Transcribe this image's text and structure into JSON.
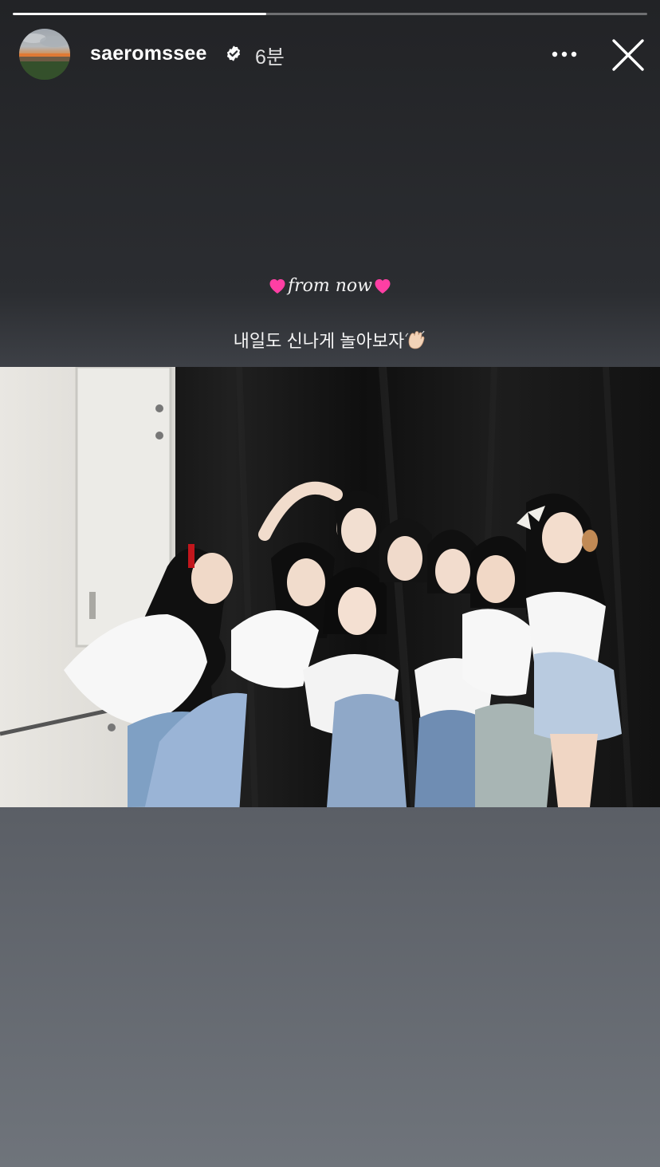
{
  "story": {
    "progress_fraction": 0.4
  },
  "header": {
    "username": "saeromssee",
    "time": "6분",
    "verified": true
  },
  "icons": {
    "more": "more-horizontal-icon",
    "close": "close-icon",
    "verified": "verified-badge-icon",
    "heart": "pink-heart-emoji",
    "wave": "waving-hand-emoji"
  },
  "caption": {
    "title": "from now",
    "subtitle": "내일도 신나게 놀아보자"
  },
  "colors": {
    "heart": "#ff3fa4",
    "background_top": "#222326",
    "background_bottom": "#6f747b"
  }
}
